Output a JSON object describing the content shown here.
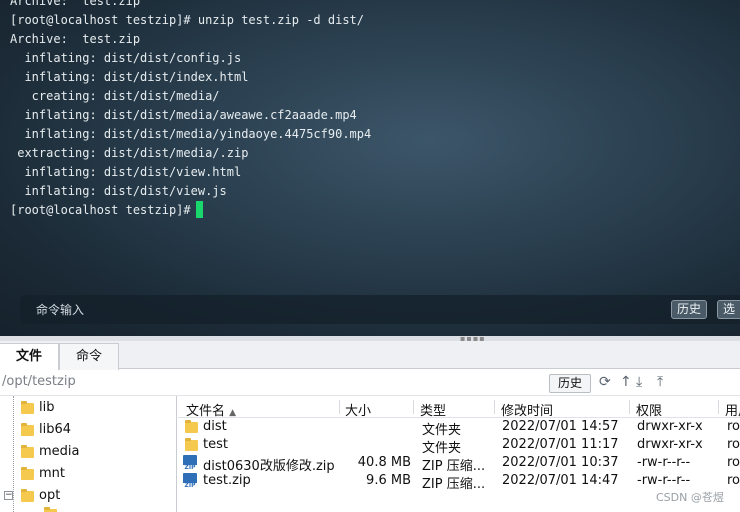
{
  "terminal": {
    "lines": [
      "Archive:  test.zip",
      "[root@localhost testzip]# unzip test.zip -d dist/",
      "Archive:  test.zip",
      "  inflating: dist/dist/config.js",
      "  inflating: dist/dist/index.html",
      "   creating: dist/dist/media/",
      "  inflating: dist/dist/media/aweawe.cf2aaade.mp4",
      "  inflating: dist/dist/media/yindaoye.4475cf90.mp4",
      " extracting: dist/dist/media/.zip",
      "  inflating: dist/dist/view.html",
      "  inflating: dist/dist/view.js"
    ],
    "prompt": "[root@localhost testzip]#",
    "cursor_color": "#19d76c"
  },
  "command_bar": {
    "label": "命令输入",
    "history_button": "历史",
    "select_button": "选"
  },
  "tabs": [
    {
      "label": "文件",
      "active": true
    },
    {
      "label": "命令",
      "active": false
    }
  ],
  "path_bar": {
    "path": "/opt/testzip",
    "history_button": "历史",
    "icons": [
      "refresh-icon",
      "up-arrow-icon",
      "download-icon",
      "upload-icon"
    ]
  },
  "tree": {
    "items": [
      {
        "label": "lib",
        "expander": ""
      },
      {
        "label": "lib64",
        "expander": ""
      },
      {
        "label": "media",
        "expander": ""
      },
      {
        "label": "mnt",
        "expander": ""
      },
      {
        "label": "opt",
        "expander": "−"
      }
    ]
  },
  "files": {
    "columns": [
      "文件名",
      "大小",
      "类型",
      "修改时间",
      "权限",
      "用户"
    ],
    "sort_indicator": "▲",
    "rows": [
      {
        "name": "dist",
        "size": "",
        "type": "文件夹",
        "modified": "2022/07/01 14:57",
        "perm": "drwxr-xr-x",
        "user": "ro",
        "icon": "folder-icon"
      },
      {
        "name": "test",
        "size": "",
        "type": "文件夹",
        "modified": "2022/07/01 11:17",
        "perm": "drwxr-xr-x",
        "user": "ro",
        "icon": "folder-icon"
      },
      {
        "name": "dist0630改版修改.zip",
        "size": "40.8 MB",
        "type": "ZIP 压缩...",
        "modified": "2022/07/01 10:37",
        "perm": "-rw-r--r--",
        "user": "ro",
        "icon": "zip-file-icon"
      },
      {
        "name": "test.zip",
        "size": "9.6 MB",
        "type": "ZIP 压缩...",
        "modified": "2022/07/01 14:47",
        "perm": "-rw-r--r--",
        "user": "ro",
        "icon": "zip-file-icon"
      }
    ]
  },
  "watermark": "CSDN @苍煜"
}
